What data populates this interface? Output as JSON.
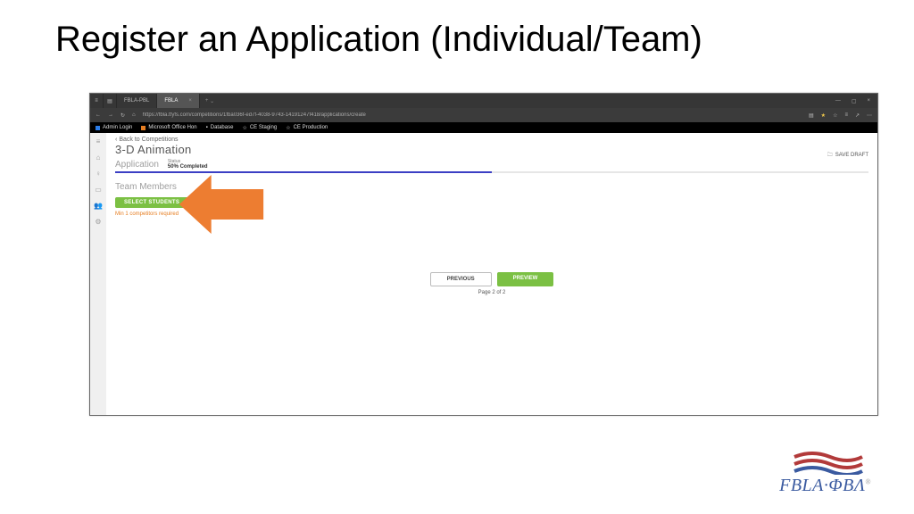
{
  "slide_title": "Register an Application (Individual/Team)",
  "browser": {
    "tab_inactive": "FBLA-PBL",
    "tab_active": "FBLA",
    "url": "https://fbla.tfyfs.com/competitions/1fba036f-ed7f-4038-9743-14191247f418/applications/create",
    "favorites": {
      "f1": "Admin Login",
      "f2": "Microsoft Office Hon",
      "f3": "Database",
      "f4": "CE Staging",
      "f5": "CE Production"
    },
    "close": "×",
    "plus": "+",
    "down": "⌄",
    "min": "—",
    "max": "▢",
    "dots": "⋯",
    "back": "←",
    "fwd": "→",
    "reload": "↻",
    "home": "⌂",
    "reader": "▤",
    "favstar": "★",
    "fav2": "☆",
    "hub": "≡",
    "share": "↗"
  },
  "sidebar": {
    "i1": "≡",
    "i2": "⌂",
    "i3": "♀",
    "i4": "▭",
    "i5": "👥",
    "i6": "⚙"
  },
  "app": {
    "back": "Back to Competitions",
    "title": "3-D Animation",
    "app_label": "Application",
    "status_lbl": "Status",
    "status_val": "50% Completed",
    "progress_pct": 50,
    "team_label": "Team Members",
    "select_btn": "SELECT STUDENTS",
    "warn": "Min 1 competitors required",
    "prev": "PREVIOUS",
    "next": "PREVIEW",
    "pager": "Page 2 of 2",
    "save": "SAVE DRAFT",
    "save_icon": "🗀"
  },
  "logo_text": "FBLA·ΦΒΛ"
}
